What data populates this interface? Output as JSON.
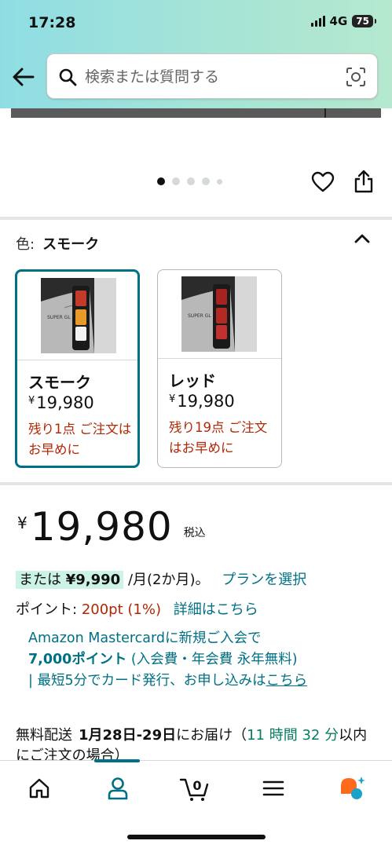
{
  "status_bar": {
    "time": "17:28",
    "network": "4G",
    "battery": "75"
  },
  "search": {
    "placeholder": "検索または質問する"
  },
  "gallery": {
    "dot_count": 5,
    "active_index": 0
  },
  "variation": {
    "label": "色:",
    "selected": "スモーク",
    "options": [
      {
        "name": "スモーク",
        "currency": "¥",
        "price": "19,980",
        "stock": "残り1点 ご注文はお早めに"
      },
      {
        "name": "レッド",
        "currency": "¥",
        "price": "19,980",
        "stock": "残り19点 ご注文はお早めに"
      }
    ]
  },
  "price": {
    "currency": "¥",
    "amount": "19,980",
    "tax_label": "税込"
  },
  "installment": {
    "prefix": "または",
    "amount": "¥9,990",
    "suffix": "/月(2か月)。",
    "link": "プランを選択"
  },
  "points": {
    "label": "ポイント:",
    "value": "200pt",
    "percent": "(1%)",
    "link": "詳細はこちら"
  },
  "promo": {
    "line1": "Amazon Mastercardに新規ご入会で",
    "points_bold": "7,000ポイント",
    "line2_rest": " (入会費・年会費 永年無料)",
    "line3": "| 最短5分でカード発行、お申し込みは",
    "link": "こちら"
  },
  "delivery": {
    "label": "無料配送",
    "date": "1月28日-29日",
    "middle": "にお届け（",
    "countdown": "11 時間 32 分",
    "suffix": "以内にご注文の場合）"
  },
  "nav": {
    "items": [
      "home-icon",
      "account-icon",
      "cart-icon",
      "menu-icon",
      "rufus-icon"
    ],
    "cart_count": "0",
    "active": "account-icon"
  },
  "colors": {
    "accent": "#007185",
    "price_red": "#b12704",
    "green": "#067d62",
    "header_gradient_start": "#8fdde4",
    "header_gradient_end": "#b5e8cf"
  }
}
